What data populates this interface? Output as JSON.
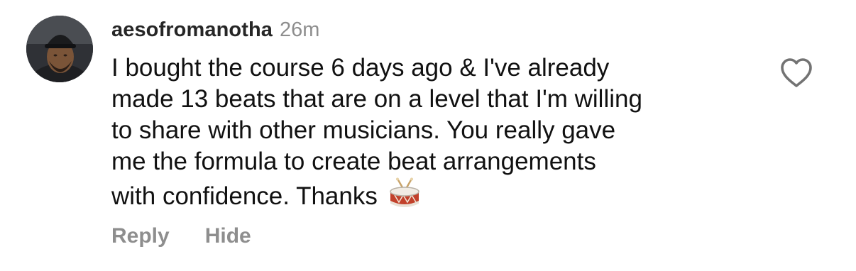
{
  "comment": {
    "username": "aesofromanotha",
    "timestamp": "26m",
    "text_lines": [
      "I bought the course 6 days ago & I've already",
      "made 13 beats that are on a level that I'm willing",
      "to share with other musicians. You really gave",
      "me the formula to create beat arrangements",
      "with confidence. Thanks"
    ],
    "emoji": "drum-emoji",
    "actions": {
      "reply_label": "Reply",
      "hide_label": "Hide"
    },
    "like_icon": "heart-outline-icon"
  },
  "colors": {
    "username": "#262626",
    "secondary": "#8e8e8e",
    "text": "#111111",
    "background": "#ffffff"
  }
}
